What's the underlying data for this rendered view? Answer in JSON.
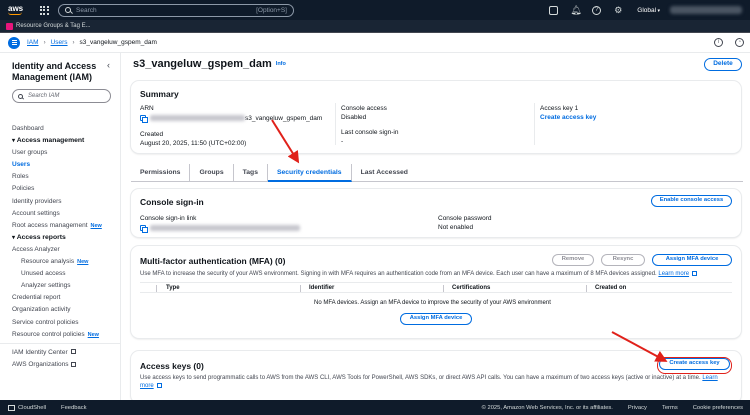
{
  "topnav": {
    "logo": "aws",
    "search_placeholder": "Search",
    "search_shortcut": "[Option+S]",
    "region": "Global",
    "icons": [
      "cloudshell-icon",
      "bell-icon",
      "help-icon",
      "gear-icon"
    ]
  },
  "favorites": {
    "item": "Resource Groups & Tag E..."
  },
  "breadcrumb": {
    "items": [
      "IAM",
      "Users",
      "s3_vangeluw_gspem_dam"
    ]
  },
  "sidebar": {
    "title": "Identity and Access Management (IAM)",
    "search_placeholder": "Search IAM",
    "dashboard": "Dashboard",
    "access_management": "Access management",
    "user_groups": "User groups",
    "users": "Users",
    "roles": "Roles",
    "policies": "Policies",
    "identity_providers": "Identity providers",
    "account_settings": "Account settings",
    "root_access_management": "Root access management",
    "new": "New",
    "access_reports": "Access reports",
    "access_analyzer": "Access Analyzer",
    "resource_analysis": "Resource analysis",
    "unused_access": "Unused access",
    "analyzer_settings": "Analyzer settings",
    "credential_report": "Credential report",
    "organization_activity": "Organization activity",
    "service_control_policies": "Service control policies",
    "resource_control_policies": "Resource control policies",
    "iam_identity_center": "IAM Identity Center",
    "aws_organizations": "AWS Organizations"
  },
  "page": {
    "title": "s3_vangeluw_gspem_dam",
    "info": "Info",
    "delete": "Delete"
  },
  "summary": {
    "heading": "Summary",
    "arn_label": "ARN",
    "arn_suffix": "s3_vangeluw_gspem_dam",
    "created_label": "Created",
    "created_value": "August 20, 2025, 11:50 (UTC+02:00)",
    "console_access_label": "Console access",
    "console_access_value": "Disabled",
    "last_signin_label": "Last console sign-in",
    "last_signin_value": "-",
    "access_key_label": "Access key 1",
    "access_key_link": "Create access key"
  },
  "tabs": [
    "Permissions",
    "Groups",
    "Tags",
    "Security credentials",
    "Last Accessed"
  ],
  "active_tab": "Security credentials",
  "console_signin": {
    "heading": "Console sign-in",
    "button": "Enable console access",
    "link_label": "Console sign-in link",
    "password_label": "Console password",
    "password_value": "Not enabled"
  },
  "mfa": {
    "heading": "Multi-factor authentication (MFA) (0)",
    "remove": "Remove",
    "resync": "Resync",
    "assign": "Assign MFA device",
    "description": "Use MFA to increase the security of your AWS environment. Signing in with MFA requires an authentication code from an MFA device. Each user can have a maximum of 8 MFA devices assigned.",
    "learn_more": "Learn more",
    "columns": [
      "Type",
      "Identifier",
      "Certifications",
      "Created on"
    ],
    "empty": "No MFA devices. Assign an MFA device to improve the security of your AWS environment",
    "assign_center": "Assign MFA device"
  },
  "access_keys": {
    "heading": "Access keys (0)",
    "button": "Create access key",
    "description": "Use access keys to send programmatic calls to AWS from the AWS CLI, AWS Tools for PowerShell, AWS SDKs, or direct AWS API calls. You can have a maximum of two access keys (active or inactive) at a time.",
    "learn": "Learn",
    "more": "more"
  },
  "footer": {
    "cloudshell": "CloudShell",
    "feedback": "Feedback",
    "copyright": "© 2025, Amazon Web Services, Inc. or its affiliates.",
    "privacy": "Privacy",
    "terms": "Terms",
    "cookies": "Cookie preferences"
  },
  "colors": {
    "link": "#006ce0",
    "nav_bg": "#0f1b2a",
    "annotation": "#e0211a"
  }
}
